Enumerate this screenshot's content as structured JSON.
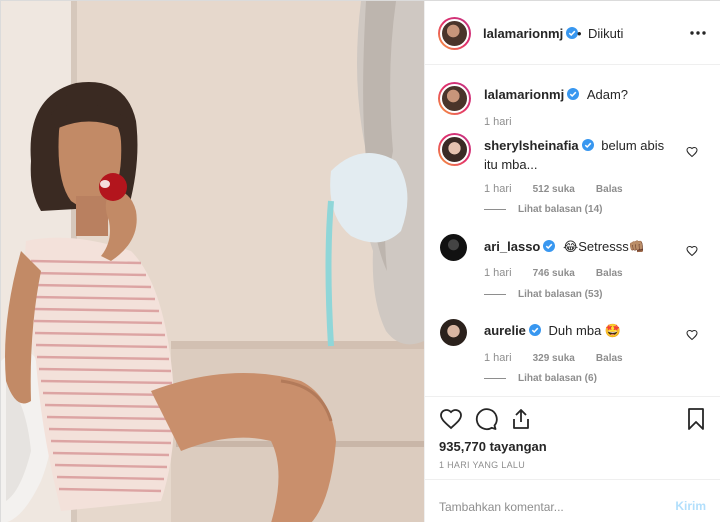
{
  "post": {
    "author": "lalamarionmj",
    "separator": "•",
    "follow_status": "Diikuti",
    "more_icon": "more-horizontal-icon",
    "colors": {
      "link_blue": "#3897f0",
      "muted": "#8e8e8e",
      "post_disabled": "#b2dffc"
    }
  },
  "caption": {
    "username": "lalamarionmj",
    "text": "Adam?",
    "time": "1 hari"
  },
  "comments": [
    {
      "username": "sherylsheinafia",
      "text": "belum abis itu mba...",
      "time": "1 hari",
      "likes": "512 suka",
      "reply": "Balas",
      "view_replies": "Lihat balasan (14)"
    },
    {
      "username": "ari_lasso",
      "text": "😂Setresss👊🏽",
      "time": "1 hari",
      "likes": "746 suka",
      "reply": "Balas",
      "view_replies": "Lihat balasan (53)"
    },
    {
      "username": "aurelie",
      "text": "Duh mba 🤩",
      "time": "1 hari",
      "likes": "329 suka",
      "reply": "Balas",
      "view_replies": "Lihat balasan (6)"
    }
  ],
  "actions": {
    "icons": [
      "heart-icon",
      "comment-icon",
      "share-icon",
      "bookmark-icon"
    ],
    "views": "935,770 tayangan",
    "posted": "1 HARI YANG LALU"
  },
  "add_comment": {
    "placeholder": "Tambahkan komentar...",
    "post_label": "Kirim"
  }
}
